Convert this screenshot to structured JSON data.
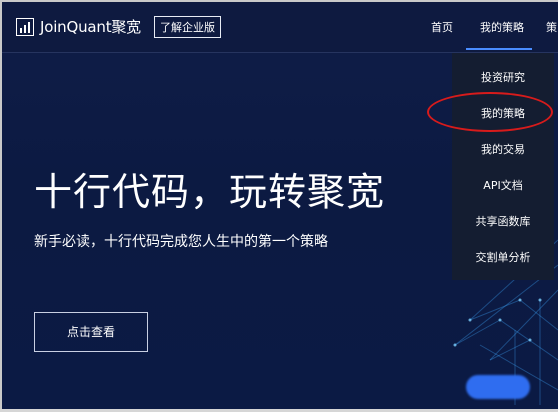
{
  "brand": {
    "name": "JoinQuant聚宽",
    "enterprise_link": "了解企业版"
  },
  "nav": {
    "home": "首页",
    "my_strategy": "我的策略",
    "cut_item": "策"
  },
  "dropdown": {
    "items": [
      "投资研究",
      "我的策略",
      "我的交易",
      "API文档",
      "共享函数库",
      "交割单分析"
    ],
    "highlighted_item": "我的策略"
  },
  "hero": {
    "title": "十行代码，玩转聚宽",
    "subtitle": "新手必读，十行代码完成您人生中的第一个策略",
    "cta": "点击查看"
  },
  "colors": {
    "background": "#0c1a42",
    "dropdown": "#141d31",
    "nav_underline": "#4a8dff",
    "annotation": "#d81b1b"
  }
}
